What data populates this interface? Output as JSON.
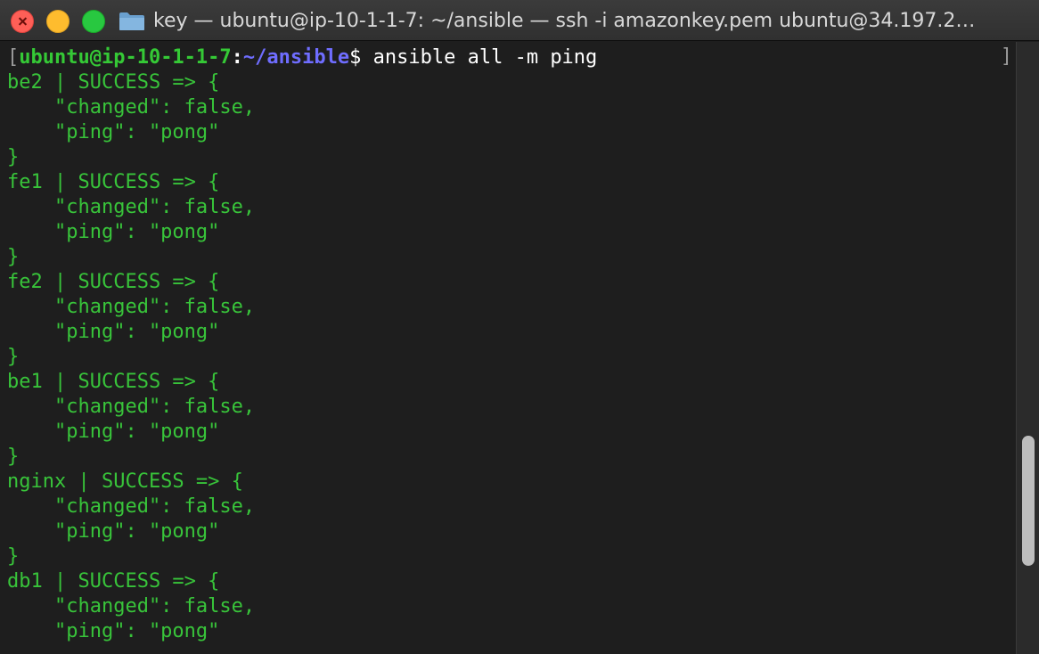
{
  "window": {
    "title": "key — ubuntu@ip-10-1-1-7: ~/ansible — ssh -i amazonkey.pem ubuntu@34.197.2…"
  },
  "prompt": {
    "open_bracket": "[",
    "user_host": "ubuntu@ip-10-1-1-7",
    "colon": ":",
    "path": "~/ansible",
    "dollar": "$",
    "command": " ansible all -m ping"
  },
  "scroll_bracket": "]",
  "output": [
    {
      "head": "be2 | SUCCESS => {",
      "changed": "    \"changed\": false,",
      "ping": "    \"ping\": \"pong\"",
      "close": "}"
    },
    {
      "head": "fe1 | SUCCESS => {",
      "changed": "    \"changed\": false,",
      "ping": "    \"ping\": \"pong\"",
      "close": "}"
    },
    {
      "head": "fe2 | SUCCESS => {",
      "changed": "    \"changed\": false,",
      "ping": "    \"ping\": \"pong\"",
      "close": "}"
    },
    {
      "head": "be1 | SUCCESS => {",
      "changed": "    \"changed\": false,",
      "ping": "    \"ping\": \"pong\"",
      "close": "}"
    },
    {
      "head": "nginx | SUCCESS => {",
      "changed": "    \"changed\": false,",
      "ping": "    \"ping\": \"pong\"",
      "close": "}"
    },
    {
      "head": "db1 | SUCCESS => {",
      "changed": "    \"changed\": false,",
      "ping": "    \"ping\": \"pong\"",
      "close": ""
    }
  ],
  "colors": {
    "output_green": "#38c43a",
    "prompt_user": "#35c936",
    "prompt_path": "#6f6dff",
    "background": "#1e1e1e"
  }
}
